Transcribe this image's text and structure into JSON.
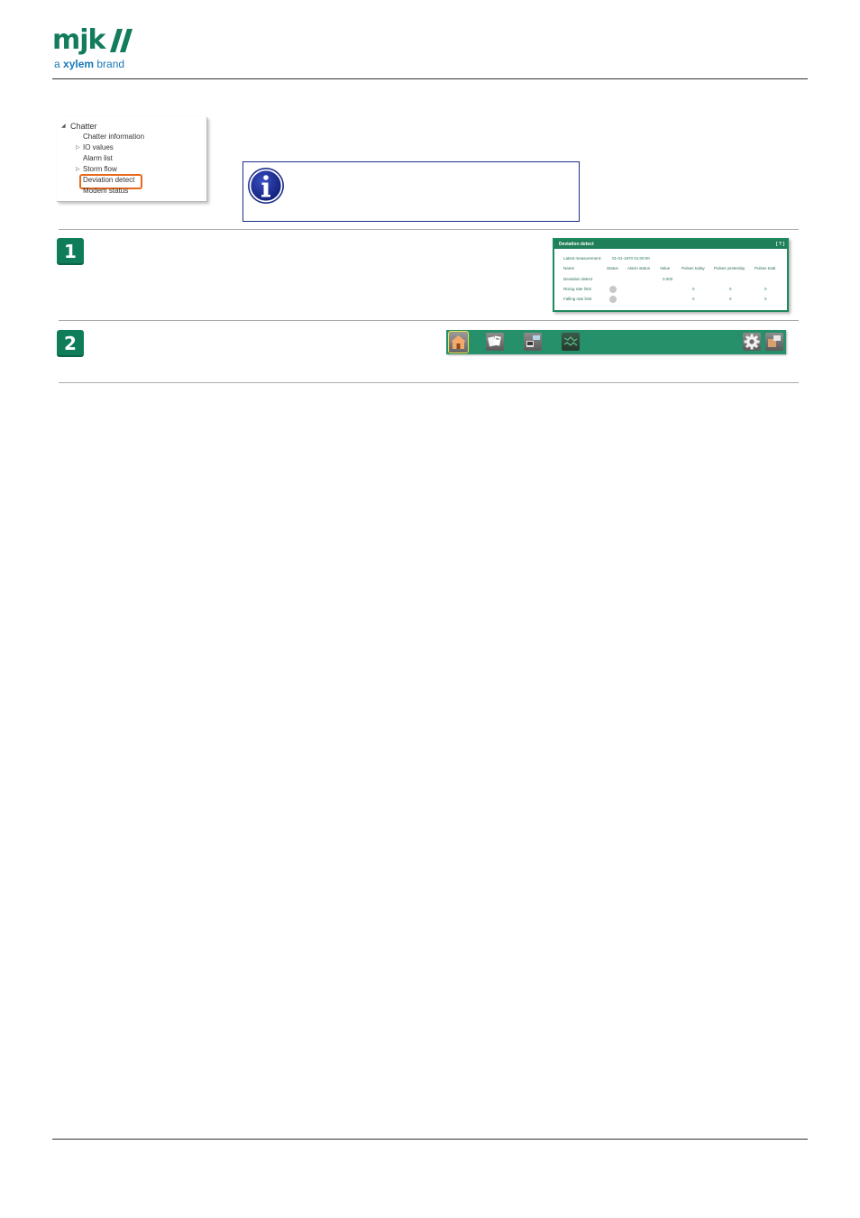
{
  "header": {
    "logo_text": "mjk",
    "logo_sub_prefix": "a ",
    "logo_sub_bold": "xylem",
    "logo_sub_suffix": " brand"
  },
  "tree": {
    "root": "Chatter",
    "items": [
      {
        "label": "Chatter information",
        "expandable": false
      },
      {
        "label": "IO values",
        "expandable": true
      },
      {
        "label": "Alarm list",
        "expandable": false
      },
      {
        "label": "Storm flow",
        "expandable": true
      },
      {
        "label": "Deviation detect",
        "expandable": false,
        "highlighted": true
      },
      {
        "label": "Modem status",
        "expandable": false
      }
    ]
  },
  "steps": {
    "step1": "1",
    "step2": "2"
  },
  "deviation_panel": {
    "title": "Deviation detect",
    "help": "[ ? ]",
    "latest_label": "Latest measurement:",
    "latest_value": "01-01-1970 01:00:00",
    "columns": [
      "Name",
      "Status",
      "Alarm status",
      "Value",
      "Pulses today",
      "Pulses yesterday",
      "Pulses total"
    ],
    "rows": [
      {
        "name": "Deviation detect",
        "value": "0.000",
        "today": "",
        "yesterday": "",
        "total": ""
      },
      {
        "name": "Rising rate limit",
        "value": "",
        "today": "0",
        "yesterday": "0",
        "total": "0"
      },
      {
        "name": "Falling rate limit",
        "value": "",
        "today": "0",
        "yesterday": "0",
        "total": "0"
      }
    ],
    "colors": {
      "header": "#1f7f58",
      "status_off": "#c8c8c8"
    }
  },
  "toolbar": {
    "buttons": [
      "home-icon",
      "cards-icon",
      "display-icon",
      "map-icon",
      "gear-icon",
      "window-icon"
    ],
    "background": "#259069",
    "active_border": "#f0e14a"
  },
  "colors": {
    "brand_green": "#127c5d",
    "brand_blue": "#1a78b8",
    "highlight": "#e8681c",
    "info_border": "#1d2d8a"
  }
}
